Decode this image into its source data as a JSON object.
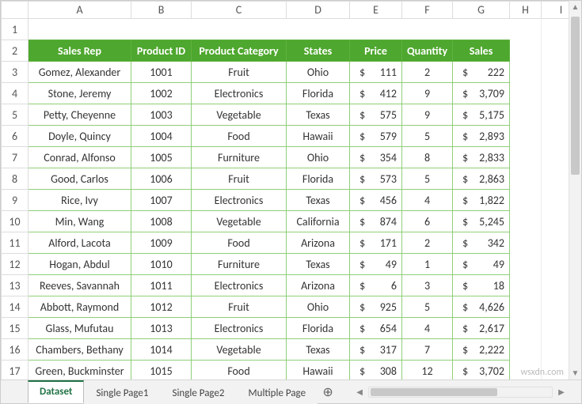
{
  "columns": [
    "A",
    "B",
    "C",
    "D",
    "E",
    "F",
    "G",
    "H",
    "I"
  ],
  "rowNumbers": [
    1,
    2,
    3,
    4,
    5,
    6,
    7,
    8,
    9,
    10,
    11,
    12,
    13,
    14,
    15,
    16,
    17
  ],
  "headers": {
    "rep": "Sales Rep",
    "pid": "Product ID",
    "cat": "Product Category",
    "state": "States",
    "price": "Price",
    "qty": "Quantity",
    "sales": "Sales"
  },
  "currency": "$",
  "rows": [
    {
      "rep": "Gomez, Alexander",
      "pid": "1001",
      "cat": "Fruit",
      "state": "Ohio",
      "price": "111",
      "qty": "2",
      "sales": "222"
    },
    {
      "rep": "Stone, Jeremy",
      "pid": "1002",
      "cat": "Electronics",
      "state": "Florida",
      "price": "412",
      "qty": "9",
      "sales": "3,709"
    },
    {
      "rep": "Petty, Cheyenne",
      "pid": "1003",
      "cat": "Vegetable",
      "state": "Texas",
      "price": "575",
      "qty": "9",
      "sales": "5,175"
    },
    {
      "rep": "Doyle, Quincy",
      "pid": "1004",
      "cat": "Food",
      "state": "Hawaii",
      "price": "579",
      "qty": "5",
      "sales": "2,893"
    },
    {
      "rep": "Conrad, Alfonso",
      "pid": "1005",
      "cat": "Furniture",
      "state": "Ohio",
      "price": "354",
      "qty": "8",
      "sales": "2,833"
    },
    {
      "rep": "Good, Carlos",
      "pid": "1006",
      "cat": "Fruit",
      "state": "Florida",
      "price": "573",
      "qty": "5",
      "sales": "2,863"
    },
    {
      "rep": "Rice, Ivy",
      "pid": "1007",
      "cat": "Electronics",
      "state": "Texas",
      "price": "456",
      "qty": "4",
      "sales": "1,822"
    },
    {
      "rep": "Min, Wang",
      "pid": "1008",
      "cat": "Vegetable",
      "state": "California",
      "price": "874",
      "qty": "6",
      "sales": "5,245"
    },
    {
      "rep": "Alford, Lacota",
      "pid": "1009",
      "cat": "Food",
      "state": "Arizona",
      "price": "171",
      "qty": "2",
      "sales": "342"
    },
    {
      "rep": "Hogan, Abdul",
      "pid": "1010",
      "cat": "Furniture",
      "state": "Texas",
      "price": "49",
      "qty": "1",
      "sales": "49"
    },
    {
      "rep": "Reeves, Savannah",
      "pid": "1011",
      "cat": "Electronics",
      "state": "Arizona",
      "price": "6",
      "qty": "3",
      "sales": "18"
    },
    {
      "rep": "Abbott, Raymond",
      "pid": "1012",
      "cat": "Fruit",
      "state": "Ohio",
      "price": "925",
      "qty": "5",
      "sales": "4,626"
    },
    {
      "rep": "Glass, Mufutau",
      "pid": "1013",
      "cat": "Electronics",
      "state": "Florida",
      "price": "654",
      "qty": "4",
      "sales": "2,617"
    },
    {
      "rep": "Chambers, Bethany",
      "pid": "1014",
      "cat": "Vegetable",
      "state": "Texas",
      "price": "317",
      "qty": "7",
      "sales": "2,222"
    },
    {
      "rep": "Green, Buckminster",
      "pid": "1015",
      "cat": "Food",
      "state": "Hawaii",
      "price": "308",
      "qty": "12",
      "sales": "3,702"
    }
  ],
  "tabs": [
    {
      "label": "Dataset",
      "active": true
    },
    {
      "label": "Single Page1",
      "active": false
    },
    {
      "label": "Single Page2",
      "active": false
    },
    {
      "label": "Multiple Page",
      "active": false
    }
  ],
  "newTabGlyph": "⊕",
  "watermark": "wsxdn.com"
}
